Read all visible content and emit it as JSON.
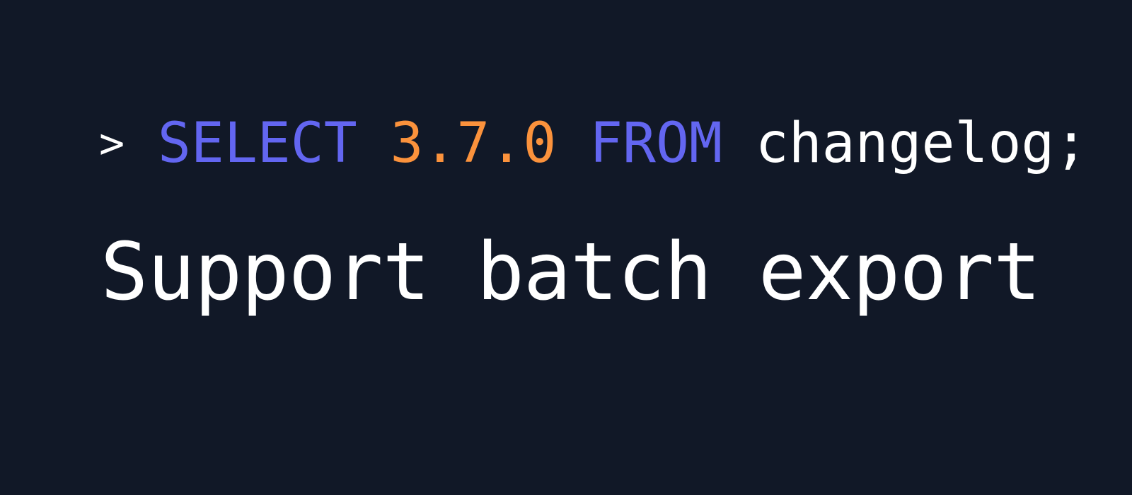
{
  "query": {
    "prompt": ">",
    "select_keyword": "SELECT",
    "version": "3.7.0",
    "from_keyword": "FROM",
    "table": "changelog;"
  },
  "headline": "Support batch export",
  "colors": {
    "background": "#111827",
    "keyword": "#6366F1",
    "version": "#FB923C",
    "text": "#FFFFFF"
  }
}
